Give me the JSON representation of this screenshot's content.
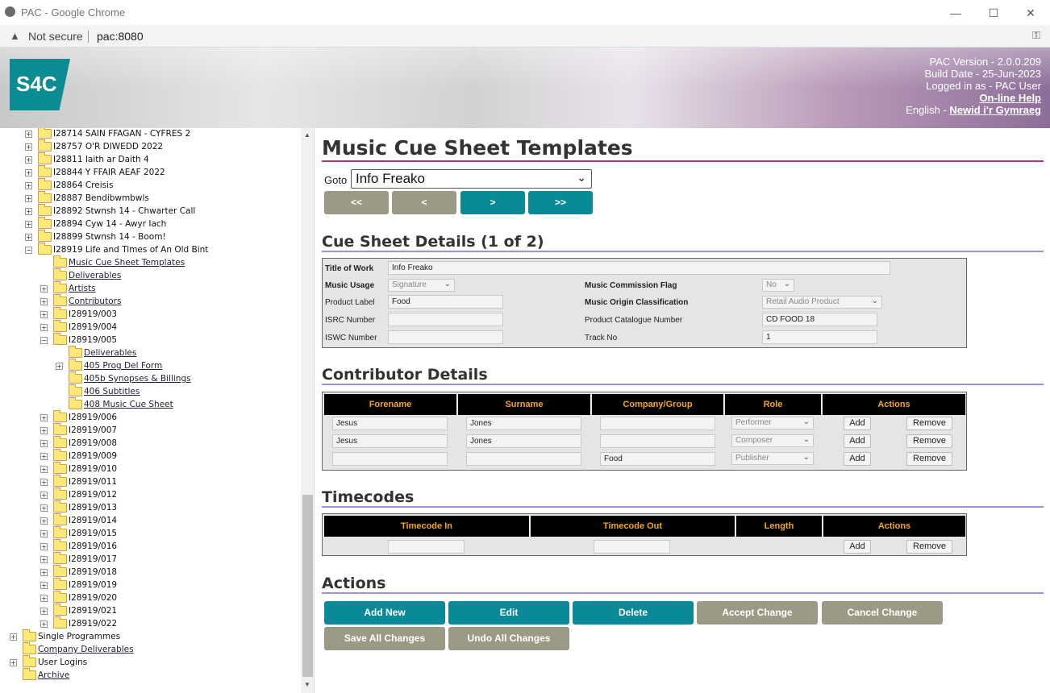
{
  "window": {
    "title": "PAC - Google Chrome",
    "minimize": "—",
    "maximize": "☐",
    "close": "✕"
  },
  "addressbar": {
    "security": "Not secure",
    "url": "pac:8080"
  },
  "banner": {
    "logo": "S4C",
    "version": "PAC Version - 2.0.0.209",
    "build": "Build Date - 25-Jun-2023",
    "login": "Logged in as - PAC User",
    "help": "On-line Help",
    "lang_prefix": "English - ",
    "lang_link": "Newid i'r Gymraeg"
  },
  "tree": [
    {
      "label": "I28714 SAIN FFAGAN - CYFRES 2",
      "level": 2,
      "exp": "+",
      "link": false
    },
    {
      "label": "I28757 O'R DIWEDD 2022",
      "level": 2,
      "exp": "+",
      "link": false
    },
    {
      "label": "I28811 Iaith ar Daith 4",
      "level": 2,
      "exp": "+",
      "link": false
    },
    {
      "label": "I28844 Y FFAIR AEAF 2022",
      "level": 2,
      "exp": "+",
      "link": false
    },
    {
      "label": "I28864 Creisis",
      "level": 2,
      "exp": "+",
      "link": false
    },
    {
      "label": "I28887 Bendibwmbwls",
      "level": 2,
      "exp": "+",
      "link": false
    },
    {
      "label": "I28892 Stwnsh 14 - Chwarter Call",
      "level": 2,
      "exp": "+",
      "link": false
    },
    {
      "label": "I28894 Cyw 14 - Awyr Iach",
      "level": 2,
      "exp": "+",
      "link": false
    },
    {
      "label": "I28899 Stwnsh 14 - Boom!",
      "level": 2,
      "exp": "+",
      "link": false
    },
    {
      "label": "I28919 Life and Times of An Old Bint",
      "level": 2,
      "exp": "-",
      "link": false
    },
    {
      "label": "Music Cue Sheet Templates",
      "level": 3,
      "exp": "",
      "link": true
    },
    {
      "label": "Deliverables",
      "level": 3,
      "exp": "",
      "link": true
    },
    {
      "label": "Artists",
      "level": 3,
      "exp": "+",
      "link": true
    },
    {
      "label": "Contributors",
      "level": 3,
      "exp": "+",
      "link": true
    },
    {
      "label": "I28919/003",
      "level": 3,
      "exp": "+",
      "link": false
    },
    {
      "label": "I28919/004",
      "level": 3,
      "exp": "+",
      "link": false
    },
    {
      "label": "I28919/005",
      "level": 3,
      "exp": "-",
      "link": false
    },
    {
      "label": "Deliverables",
      "level": 4,
      "exp": "",
      "link": true
    },
    {
      "label": "405 Prog Del Form",
      "level": 4,
      "exp": "+",
      "link": true
    },
    {
      "label": "405b Synopses & Billings",
      "level": 4,
      "exp": "",
      "link": true
    },
    {
      "label": "406 Subtitles",
      "level": 4,
      "exp": "",
      "link": true
    },
    {
      "label": "408 Music Cue Sheet",
      "level": 4,
      "exp": "",
      "link": true
    },
    {
      "label": "I28919/006",
      "level": 3,
      "exp": "+",
      "link": false
    },
    {
      "label": "I28919/007",
      "level": 3,
      "exp": "+",
      "link": false
    },
    {
      "label": "I28919/008",
      "level": 3,
      "exp": "+",
      "link": false
    },
    {
      "label": "I28919/009",
      "level": 3,
      "exp": "+",
      "link": false
    },
    {
      "label": "I28919/010",
      "level": 3,
      "exp": "+",
      "link": false
    },
    {
      "label": "I28919/011",
      "level": 3,
      "exp": "+",
      "link": false
    },
    {
      "label": "I28919/012",
      "level": 3,
      "exp": "+",
      "link": false
    },
    {
      "label": "I28919/013",
      "level": 3,
      "exp": "+",
      "link": false
    },
    {
      "label": "I28919/014",
      "level": 3,
      "exp": "+",
      "link": false
    },
    {
      "label": "I28919/015",
      "level": 3,
      "exp": "+",
      "link": false
    },
    {
      "label": "I28919/016",
      "level": 3,
      "exp": "+",
      "link": false
    },
    {
      "label": "I28919/017",
      "level": 3,
      "exp": "+",
      "link": false
    },
    {
      "label": "I28919/018",
      "level": 3,
      "exp": "+",
      "link": false
    },
    {
      "label": "I28919/019",
      "level": 3,
      "exp": "+",
      "link": false
    },
    {
      "label": "I28919/020",
      "level": 3,
      "exp": "+",
      "link": false
    },
    {
      "label": "I28919/021",
      "level": 3,
      "exp": "+",
      "link": false
    },
    {
      "label": "I28919/022",
      "level": 3,
      "exp": "+",
      "link": false
    },
    {
      "label": "Single Programmes",
      "level": 1,
      "exp": "+",
      "link": false
    },
    {
      "label": "Company Deliverables",
      "level": 1,
      "exp": "",
      "link": true
    },
    {
      "label": "User Logins",
      "level": 1,
      "exp": "+",
      "link": false
    },
    {
      "label": "Archive",
      "level": 1,
      "exp": "",
      "link": true
    }
  ],
  "main": {
    "title": "Music Cue Sheet Templates",
    "goto_label": "Goto",
    "goto_value": "Info Freako",
    "nav": [
      "<<",
      "<",
      ">",
      ">>"
    ],
    "details_heading": "Cue Sheet Details (1 of 2)",
    "details": {
      "title_label": "Title of Work",
      "title_value": "Info Freako",
      "usage_label": "Music Usage",
      "usage_value": "Signature",
      "product_label": "Product Label",
      "product_value": "Food",
      "isrc_label": "ISRC Number",
      "isrc_value": "",
      "iswc_label": "ISWC Number",
      "iswc_value": "",
      "commission_label": "Music Commission Flag",
      "commission_value": "No",
      "origin_label": "Music Origin Classification",
      "origin_value": "Retail Audio Product",
      "catalogue_label": "Product Catalogue Number",
      "catalogue_value": "CD FOOD 18",
      "track_label": "Track No",
      "track_value": "1"
    },
    "contrib_heading": "Contributor Details",
    "contrib_headers": [
      "Forename",
      "Surname",
      "Company/Group",
      "Role",
      "Actions"
    ],
    "contrib_rows": [
      {
        "forename": "Jesus",
        "surname": "Jones",
        "company": "",
        "role": "Performer"
      },
      {
        "forename": "Jesus",
        "surname": "Jones",
        "company": "",
        "role": "Composer"
      },
      {
        "forename": "",
        "surname": "",
        "company": "Food",
        "role": "Publisher"
      }
    ],
    "add_label": "Add",
    "remove_label": "Remove",
    "timecodes_heading": "Timecodes",
    "timecode_headers": [
      "Timecode In",
      "Timecode Out",
      "Length",
      "Actions"
    ],
    "actions_heading": "Actions",
    "actions": [
      {
        "label": "Add New",
        "style": "teal"
      },
      {
        "label": "Edit",
        "style": "teal"
      },
      {
        "label": "Delete",
        "style": "teal"
      },
      {
        "label": "Accept Change",
        "style": "grey"
      },
      {
        "label": "Cancel Change",
        "style": "grey"
      },
      {
        "label": "Save All Changes",
        "style": "grey"
      },
      {
        "label": "Undo All Changes",
        "style": "grey"
      }
    ]
  },
  "colors": {
    "teal": "#0a8a96",
    "grey": "#9a9a86",
    "title_rule": "#b0307d",
    "section_rule": "#a08fe0",
    "header_text": "#f4a619"
  }
}
